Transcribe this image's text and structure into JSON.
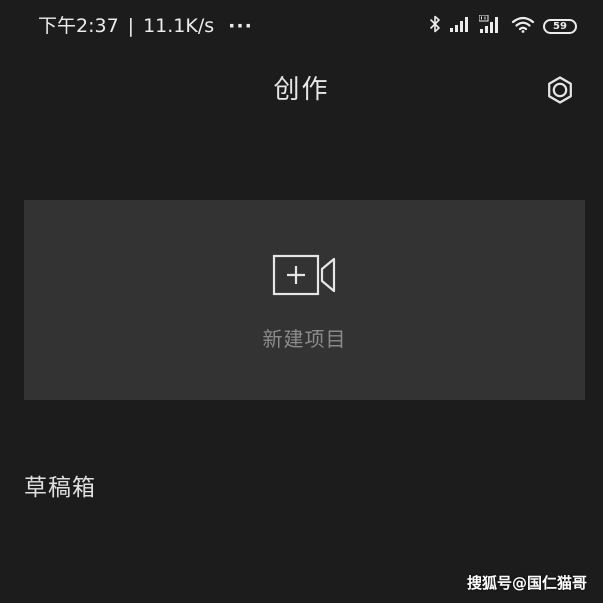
{
  "status_bar": {
    "time": "下午2:37",
    "separator": "|",
    "network_speed": "11.1K/s",
    "more": "···",
    "battery_level": "59",
    "icons": [
      "bluetooth-icon",
      "signal-icon",
      "hd-signal-icon",
      "wifi-icon",
      "battery-icon"
    ]
  },
  "header": {
    "title": "创作",
    "settings_icon": "gear-icon"
  },
  "new_project": {
    "icon": "camera-plus-icon",
    "label": "新建项目"
  },
  "drafts": {
    "title": "草稿箱"
  },
  "watermark": {
    "text": "搜狐号@国仁猫哥"
  },
  "colors": {
    "background": "#1c1c1c",
    "card": "#333333",
    "primary_text": "#e6e6e6",
    "secondary_text": "#8b8b8b",
    "icon": "#e6e6e6"
  }
}
